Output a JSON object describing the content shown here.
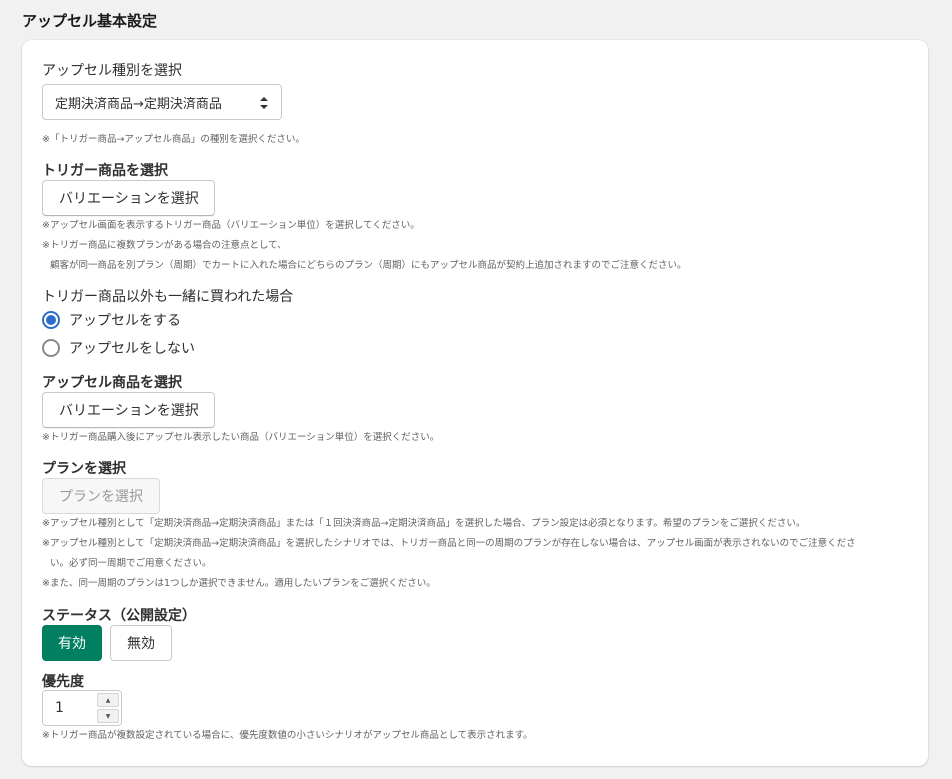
{
  "page_title": "アップセル基本設定",
  "upsell_type": {
    "label": "アップセル種別を選択",
    "selected": "定期決済商品→定期決済商品",
    "note": "※「トリガー商品→アップセル商品」の種別を選択ください。"
  },
  "trigger": {
    "label": "トリガー商品を選択",
    "button": "バリエーションを選択",
    "notes": [
      "※アップセル画面を表示するトリガー商品（バリエーション単位）を選択してください。",
      "※トリガー商品に複数プランがある場合の注意点として、",
      "顧客が同一商品を別プラン（周期）でカートに入れた場合にどちらのプラン（周期）にもアップセル商品が契約上追加されますのでご注意ください。"
    ]
  },
  "other_items": {
    "label": "トリガー商品以外も一緒に買われた場合",
    "options": [
      "アップセルをする",
      "アップセルをしない"
    ],
    "selected_index": 0
  },
  "upsell_product": {
    "label": "アップセル商品を選択",
    "button": "バリエーションを選択",
    "note": "※トリガー商品購入後にアップセル表示したい商品（バリエーション単位）を選択ください。"
  },
  "plan": {
    "label": "プランを選択",
    "button": "プランを選択",
    "notes": [
      "※アップセル種別として「定期決済商品→定期決済商品」または「１回決済商品→定期決済商品」を選択した場合、プラン設定は必須となります。希望のプランをご選択ください。",
      "※アップセル種別として「定期決済商品→定期決済商品」を選択したシナリオでは、トリガー商品と同一の周期のプランが存在しない場合は、アップセル画面が表示されないのでご注意くださ",
      "い。必ず同一周期でご用意ください。",
      "※また、同一周期のプランは1つしか選択できません。適用したいプランをご選択ください。"
    ]
  },
  "status": {
    "label": "ステータス（公開設定）",
    "active": "有効",
    "inactive": "無効"
  },
  "priority": {
    "label": "優先度",
    "value": "1",
    "note": "※トリガー商品が複数設定されている場合に、優先度数値の小さいシナリオがアップセル商品として表示されます。"
  },
  "colors": {
    "primary_button": "#008060",
    "radio_selected": "#2c6ecb"
  }
}
